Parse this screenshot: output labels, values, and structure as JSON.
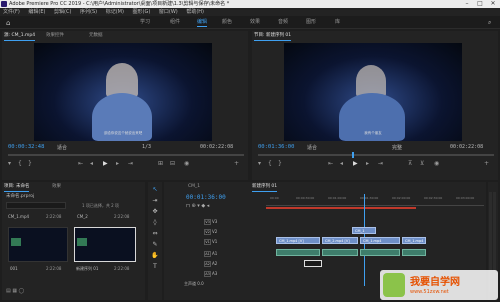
{
  "window": {
    "title": "Adobe Premiere Pro CC 2019 - C:\\用户\\Administrator\\桌面\\项目新建\\1.3\\剪辑与保存\\未命名 *"
  },
  "menu": [
    "文件(F)",
    "编辑(E)",
    "剪辑(C)",
    "序列(S)",
    "标记(M)",
    "图形(G)",
    "窗口(W)",
    "帮助(H)"
  ],
  "workspaces": [
    "学习",
    "组件",
    "编辑",
    "颜色",
    "效果",
    "音频",
    "图形",
    "库"
  ],
  "active_workspace": "编辑",
  "source_monitor": {
    "tabs": [
      "源: CM_1.mp4",
      "效果控件",
      "元数据"
    ],
    "timecode_in": "00:00:32:48",
    "fit": "适合",
    "scale": "1/3",
    "duration": "00:02:22:08",
    "subtitle": "该给你说这个就说出来吧"
  },
  "program_monitor": {
    "tabs": [
      "节目: 新建序列 01"
    ],
    "timecode_in": "00:01:36:00",
    "fit": "适合",
    "quality": "完整",
    "duration": "00:02:22:08",
    "subtitle": "我有个朋友"
  },
  "project": {
    "tabs": [
      "项目: 未命名",
      "效果"
    ],
    "name": "未命名.prproj",
    "count": "1 项已选择，共 2 项",
    "items": [
      {
        "name": "CM_1.mp4",
        "duration": "2:22:08"
      },
      {
        "name": "CM_2",
        "duration": "2:22:08"
      }
    ],
    "thumb_labels": [
      {
        "name": "001",
        "duration": "2:22:08"
      },
      {
        "name": "新建序列 01",
        "duration": "2:22:08"
      }
    ]
  },
  "timeline": {
    "tabs": [
      "CM_1",
      "新建序列 01"
    ],
    "timecode": "00:01:36:00",
    "ruler": [
      "00:00",
      "00:00:30:00",
      "00:01:00:00",
      "00:01:30:00",
      "00:02:00:00",
      "00:02:30:00",
      "00:03:00:00"
    ],
    "tracks": [
      "V3",
      "V2",
      "V1",
      "A1",
      "A2",
      "A3",
      "主声道"
    ],
    "master_value": "0.0",
    "video_clips": [
      "CM_1.mp4 [V]",
      "CM_2.mp4 [V]",
      "CM_1.mp4",
      "CM_1.mp4"
    ],
    "top_clip": "CM_1"
  },
  "watermark": {
    "cn": "我要自学网",
    "url": "www.51zxw.net"
  },
  "colors": {
    "accent": "#3fa0f0",
    "video_clip": "#6e8fc7",
    "audio_clip": "#3e7d6b"
  }
}
